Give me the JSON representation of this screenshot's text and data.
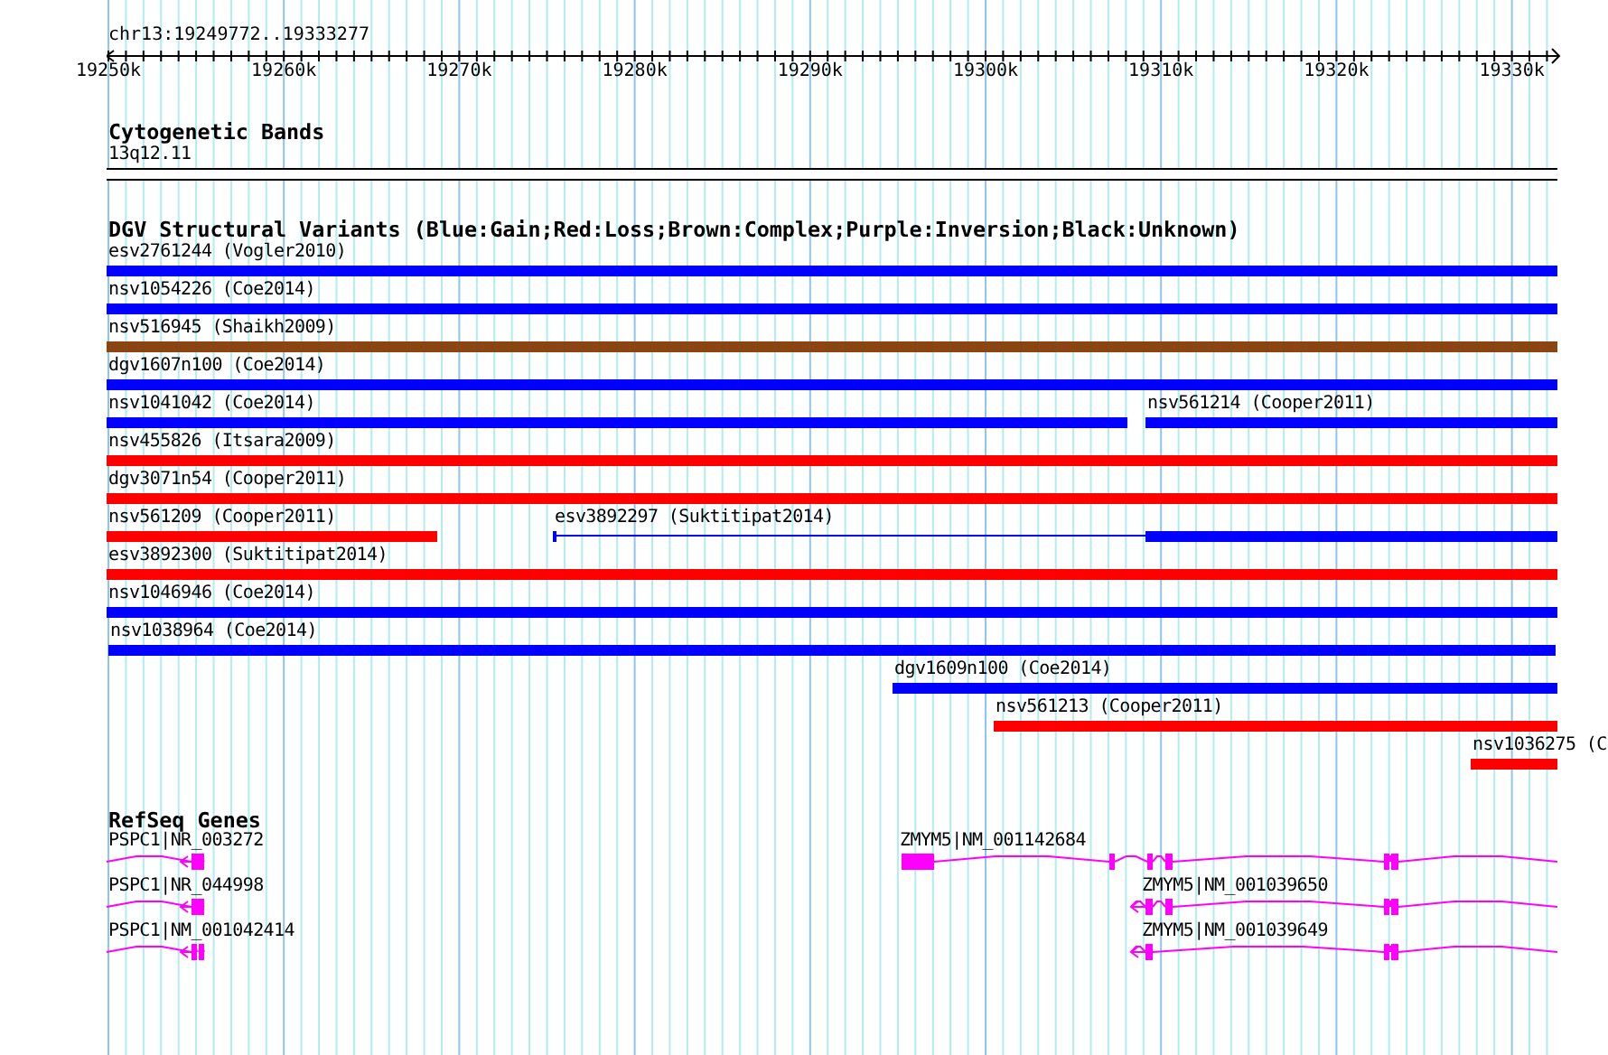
{
  "location": "chr13:19249772..19333277",
  "ruler": {
    "ticks": [
      "19250k",
      "19260k",
      "19270k",
      "19280k",
      "19290k",
      "19300k",
      "19310k",
      "19320k",
      "19330k"
    ]
  },
  "cytogenetic_bands": {
    "title": "Cytogenetic Bands",
    "bands": [
      {
        "label": "13q12.11"
      }
    ]
  },
  "structural_variants": {
    "title": "DGV Structural Variants (Blue:Gain;Red:Loss;Brown:Complex;Purple:Inversion;Black:Unknown)",
    "features": [
      {
        "label": "esv2761244 (Vogler2010)",
        "color": "#0000ff",
        "kind": "bar"
      },
      {
        "label": "nsv1054226 (Coe2014)",
        "color": "#0000ff",
        "kind": "bar"
      },
      {
        "label": "nsv516945 (Shaikh2009)",
        "color": "#8b4513",
        "kind": "bar"
      },
      {
        "label": "dgv1607n100 (Coe2014)",
        "color": "#0000ff",
        "kind": "bar"
      },
      {
        "label": "nsv1041042 (Coe2014)",
        "color": "#0000ff",
        "kind": "bar"
      },
      {
        "label": "nsv561214 (Cooper2011)",
        "color": "#0000ff",
        "kind": "bar"
      },
      {
        "label": "nsv455826 (Itsara2009)",
        "color": "#ff0000",
        "kind": "bar"
      },
      {
        "label": "dgv3071n54 (Cooper2011)",
        "color": "#ff0000",
        "kind": "bar"
      },
      {
        "label": "nsv561209 (Cooper2011)",
        "color": "#ff0000",
        "kind": "bar"
      },
      {
        "label": "esv3892297 (Suktitipat2014)",
        "color": "#0000ff",
        "kind": "split"
      },
      {
        "label": "esv3892300 (Suktitipat2014)",
        "color": "#ff0000",
        "kind": "bar"
      },
      {
        "label": "nsv1046946 (Coe2014)",
        "color": "#0000ff",
        "kind": "bar"
      },
      {
        "label": "nsv1038964 (Coe2014)",
        "color": "#0000ff",
        "kind": "bar"
      },
      {
        "label": "dgv1609n100 (Coe2014)",
        "color": "#0000ff",
        "kind": "bar"
      },
      {
        "label": "nsv561213 (Cooper2011)",
        "color": "#ff0000",
        "kind": "bar"
      },
      {
        "label": "nsv1036275 (C",
        "color": "#ff0000",
        "kind": "bar"
      }
    ]
  },
  "refseq_genes": {
    "title": "RefSeq Genes",
    "genes": [
      {
        "label": "PSPC1|NR_003272"
      },
      {
        "label": "PSPC1|NR_044998"
      },
      {
        "label": "PSPC1|NM_001042414"
      },
      {
        "label": "ZMYM5|NM_001142684"
      },
      {
        "label": "ZMYM5|NM_001039650"
      },
      {
        "label": "ZMYM5|NM_001039649"
      }
    ]
  }
}
